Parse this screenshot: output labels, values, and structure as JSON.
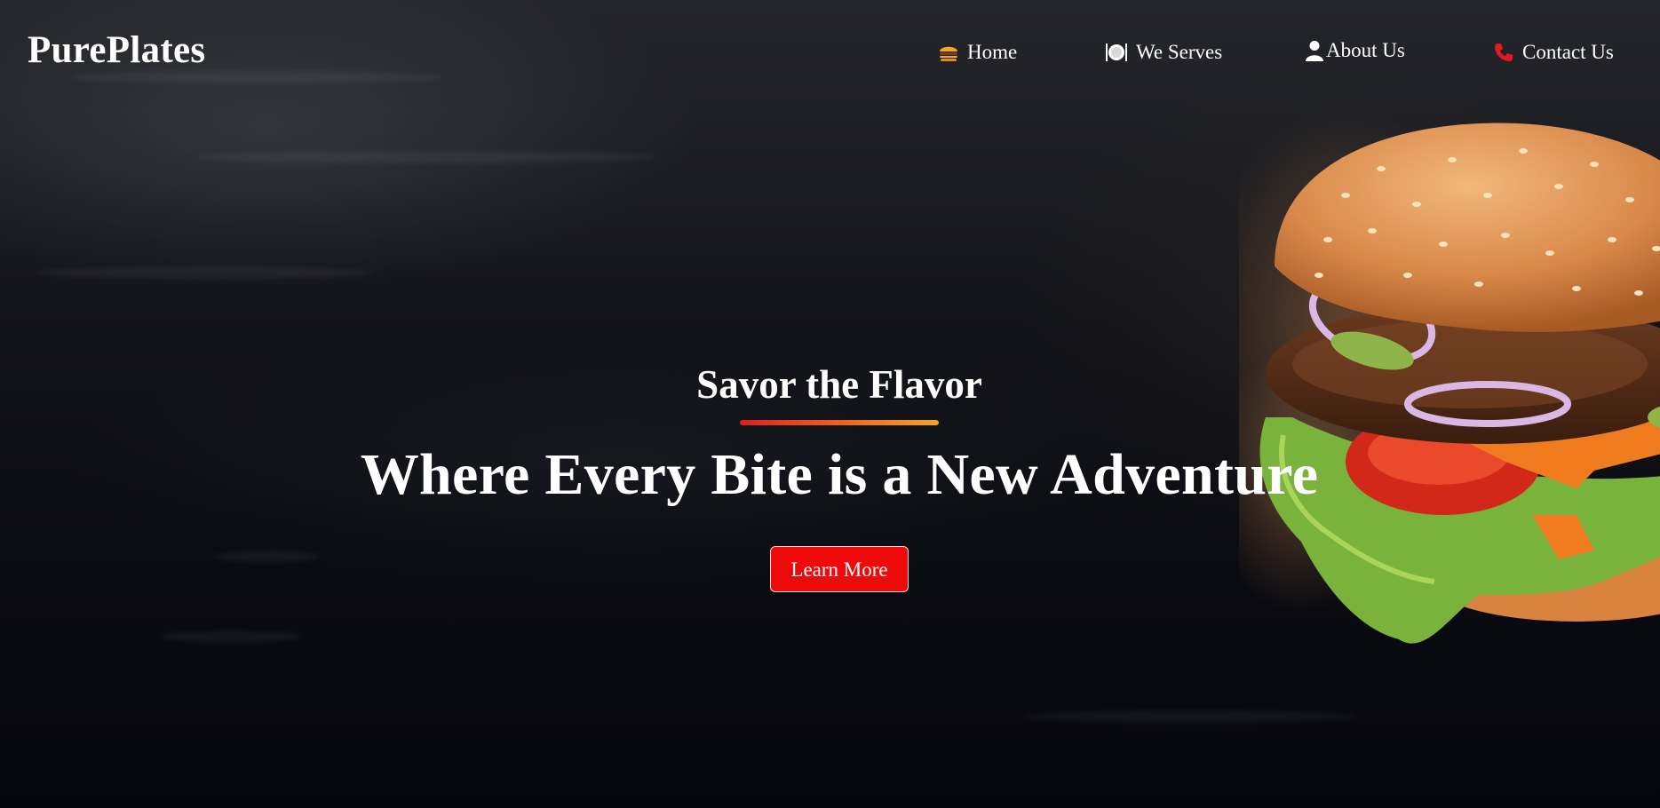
{
  "brand": {
    "name": "PurePlates"
  },
  "nav": {
    "items": [
      {
        "label": "Home",
        "icon": "burger-icon",
        "icon_color": "#f5a623"
      },
      {
        "label": "We Serves",
        "icon": "plate-cutlery-icon",
        "icon_color": "#ffffff"
      },
      {
        "label": "About Us",
        "icon": "user-icon",
        "icon_color": "#ffffff"
      },
      {
        "label": "Contact Us",
        "icon": "phone-icon",
        "icon_color": "#e31b1b"
      }
    ]
  },
  "hero": {
    "subtitle": "Savor the Flavor",
    "headline": "Where Every Bite is a New Adventure",
    "cta_label": "Learn More",
    "image": "burger-photo"
  },
  "colors": {
    "accent_red": "#ee0a0a",
    "underline_start": "#e01e1e",
    "underline_end": "#f6a41a",
    "text": "#ffffff"
  }
}
